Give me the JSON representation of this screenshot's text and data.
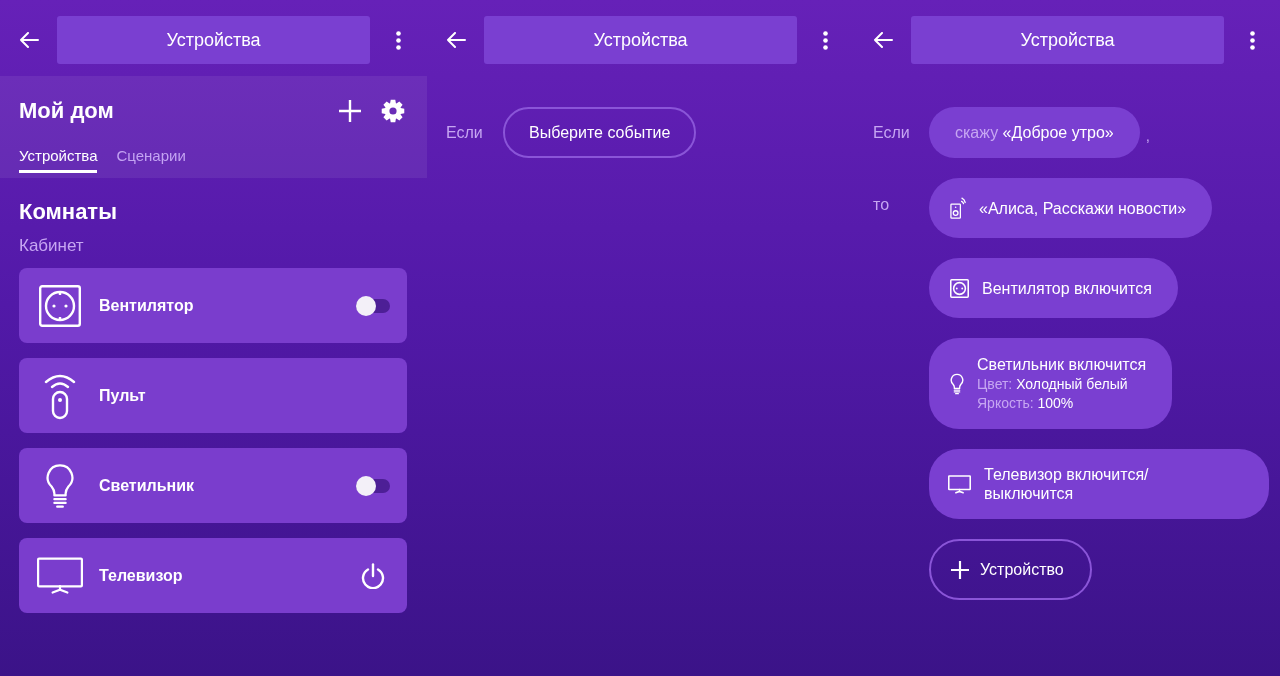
{
  "panels": [
    {
      "kind": "devices",
      "header": {
        "title": "Устройства"
      },
      "home": {
        "title": "Мой дом",
        "tabs": [
          {
            "label": "Устройства",
            "selected": true
          },
          {
            "label": "Сценарии",
            "selected": false
          }
        ]
      },
      "section_title": "Комнаты",
      "room": "Кабинет",
      "devices": [
        {
          "kind": "socket",
          "name": "Вентилятор",
          "control": {
            "kind": "toggle",
            "on": false
          }
        },
        {
          "kind": "remote",
          "name": "Пульт"
        },
        {
          "kind": "lamp",
          "name": "Светильник",
          "control": {
            "kind": "toggle",
            "on": false
          }
        },
        {
          "kind": "tv",
          "name": "Телевизор",
          "control": {
            "kind": "power"
          }
        }
      ]
    },
    {
      "kind": "new-scenario",
      "header": {
        "title": "Устройства"
      },
      "if_label": "Если",
      "event_button": "Выберите событие"
    },
    {
      "kind": "scenario",
      "header": {
        "title": "Устройства"
      },
      "if_label": "Если",
      "trigger": {
        "prefix": "скажу",
        "phrase": "«Доброе утро»"
      },
      "trigger_suffix": ",",
      "then_label": "то",
      "actions": [
        {
          "kind": "speaker",
          "text": "«Алиса, Расскажи новости»"
        },
        {
          "kind": "socket",
          "text": "Вентилятор включится"
        },
        {
          "kind": "lamp",
          "text": "Светильник включится",
          "details": [
            {
              "label": "Цвет:",
              "value": "Холодный белый"
            },
            {
              "label": "Яркость:",
              "value": "100%"
            }
          ]
        },
        {
          "kind": "tv",
          "text": "Телевизор включится/ выключится"
        }
      ],
      "add_button": "Устройство"
    }
  ]
}
